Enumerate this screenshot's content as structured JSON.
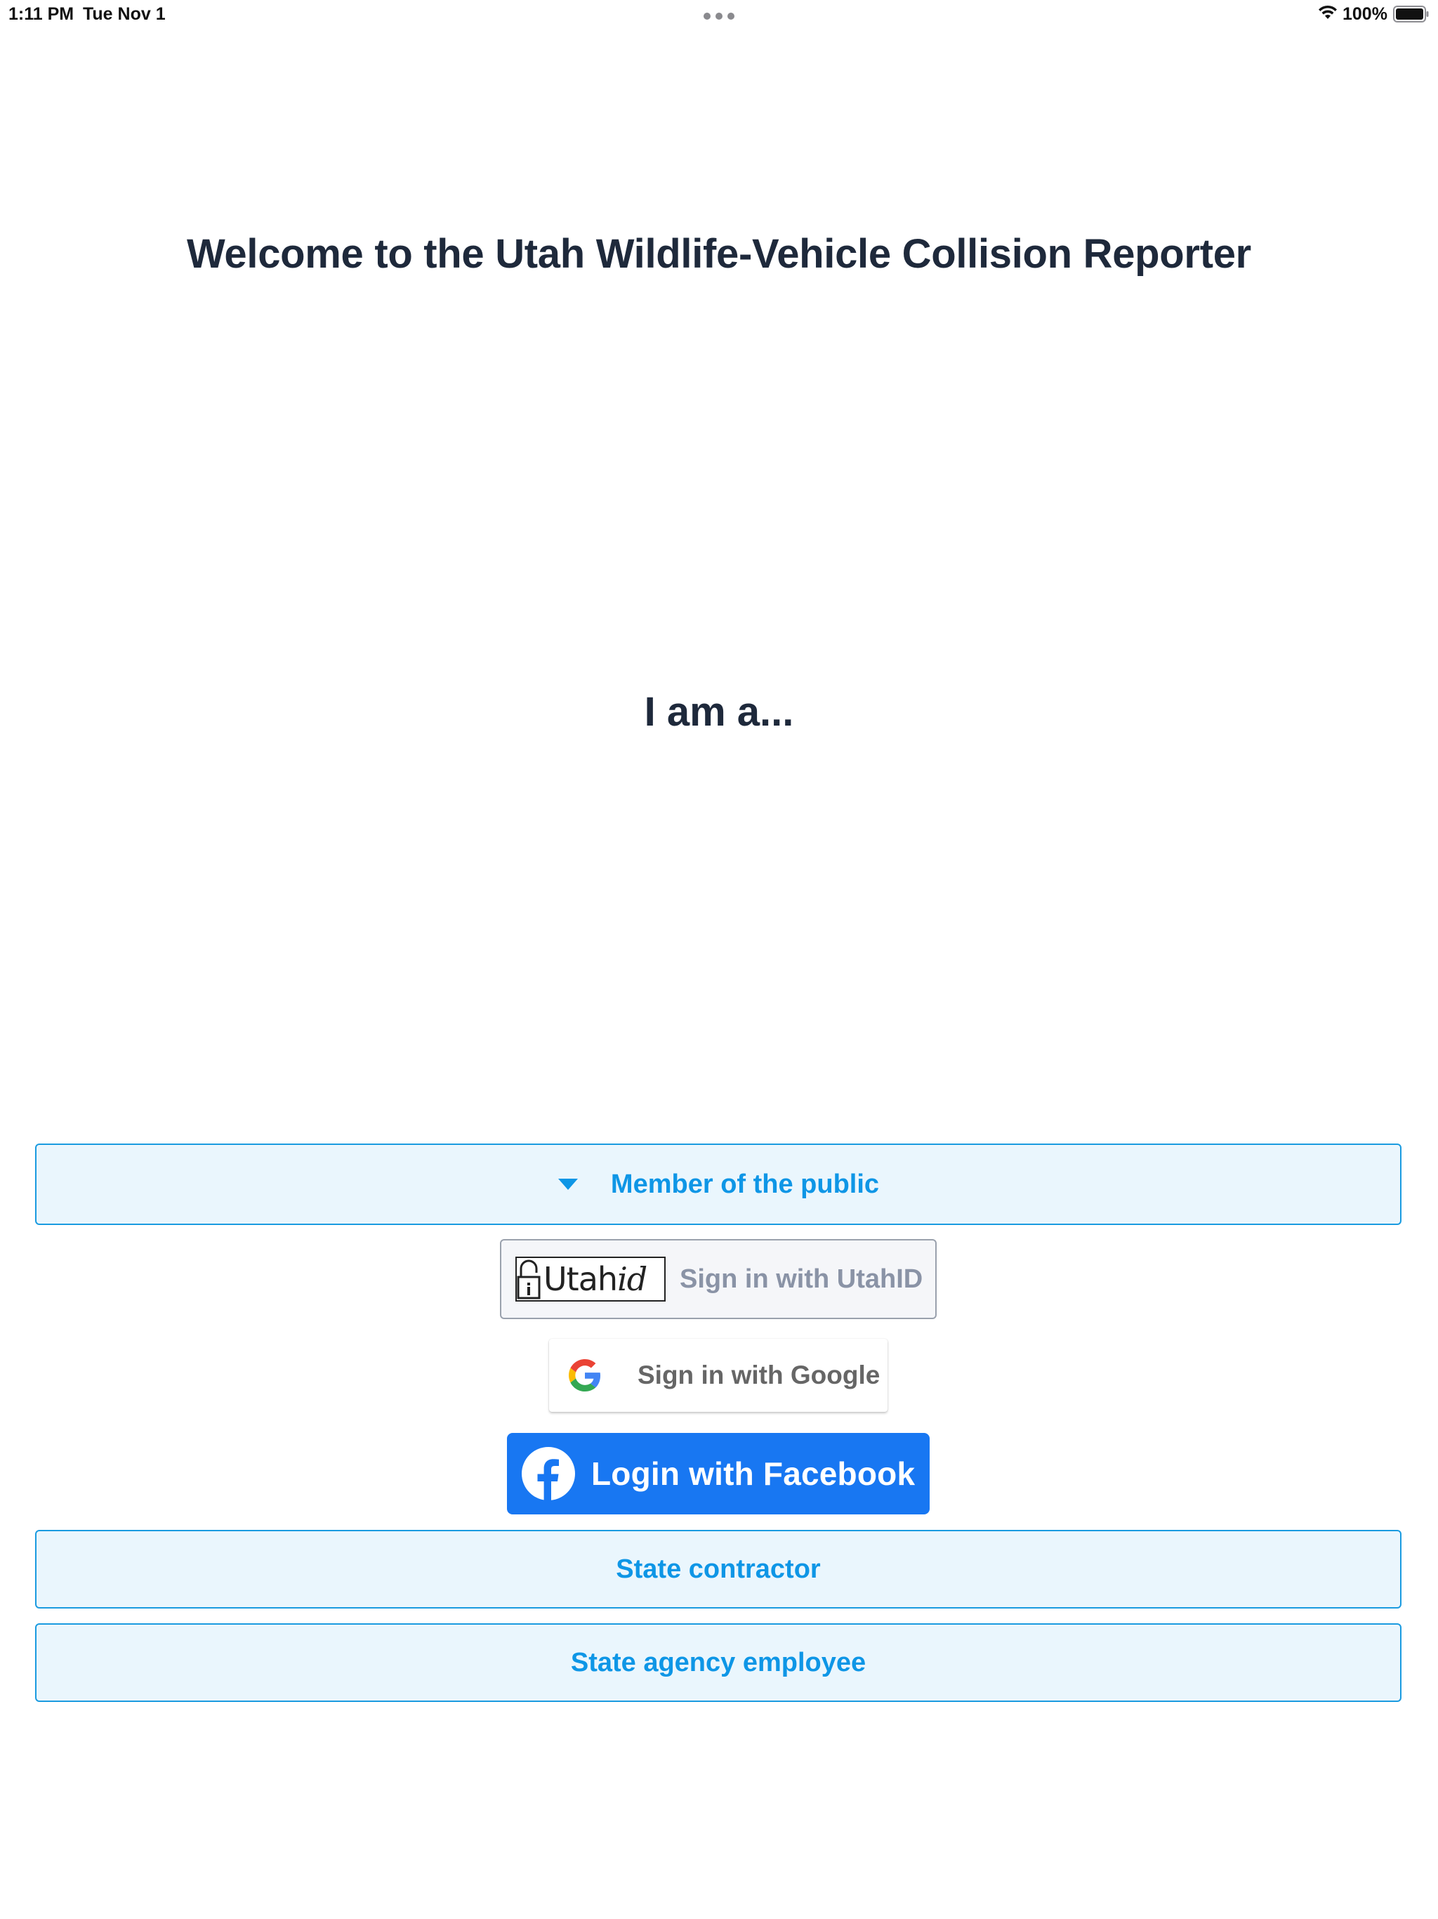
{
  "status_bar": {
    "time": "1:11 PM",
    "date": "Tue Nov 1",
    "battery": "100%",
    "icons": [
      "multitask-dots-icon",
      "wifi-icon",
      "battery-icon"
    ]
  },
  "header": {
    "title": "Welcome to the Utah Wildlife-Vehicle Collision Reporter"
  },
  "role_prompt": "I am a...",
  "roles": {
    "public": {
      "label": "Member of the public",
      "expanded": true,
      "icon": "caret-down-icon"
    },
    "contractor": {
      "label": "State contractor"
    },
    "employee": {
      "label": "State agency employee"
    }
  },
  "sign_in": {
    "utahid": {
      "logo_text": "Utah",
      "logo_text_italic": "id",
      "label": "Sign in with UtahID",
      "icon": "lock-icon"
    },
    "google": {
      "label": "Sign in with Google",
      "icon": "google-g-icon"
    },
    "facebook": {
      "label": "Login with Facebook",
      "icon": "facebook-f-icon"
    }
  },
  "colors": {
    "heading": "#1e293b",
    "role_text": "#0e96e6",
    "role_border": "#1a9be0",
    "role_background": "#eaf6fd",
    "facebook_blue": "#1877f2",
    "utahid_label": "#8a93a6"
  }
}
